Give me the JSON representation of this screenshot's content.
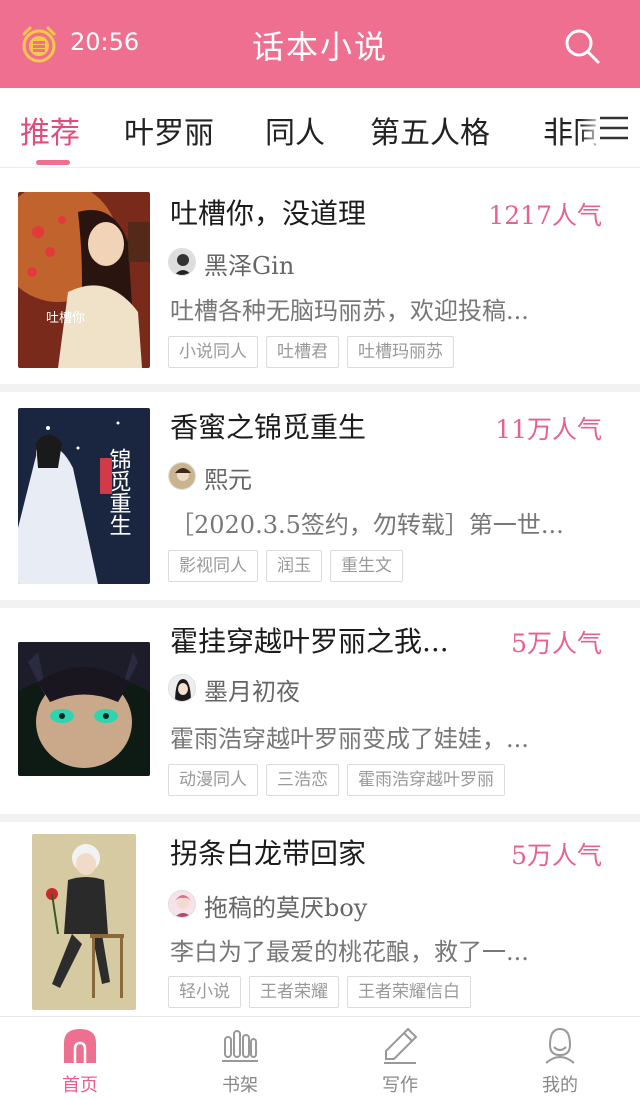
{
  "status": {
    "time": "20:56"
  },
  "appbar": {
    "title": "话本小说",
    "brand_color": "#ee6f8f"
  },
  "tabs": [
    {
      "label": "推荐",
      "active": true
    },
    {
      "label": "叶罗丽",
      "active": false
    },
    {
      "label": "同人",
      "active": false
    },
    {
      "label": "第五人格",
      "active": false
    },
    {
      "label": "非同",
      "active": false
    }
  ],
  "books": [
    {
      "title": "吐槽你，没道理",
      "popularity": "1217人气",
      "author": "黑泽Gin",
      "summary": "吐槽各种无脑玛丽苏，欢迎投稿...",
      "tags": [
        "小说同人",
        "吐槽君",
        "吐槽玛丽苏"
      ],
      "cover_text": "吐槽你"
    },
    {
      "title": "香蜜之锦觅重生",
      "popularity": "11万人气",
      "author": "熙元",
      "summary": "［2020.3.5签约，勿转载］第一世...",
      "tags": [
        "影视同人",
        "润玉",
        "重生文"
      ],
      "cover_text": "锦觅重生"
    },
    {
      "title": "霍挂穿越叶罗丽之我...",
      "popularity": "5万人气",
      "author": "墨月初夜",
      "summary": "霍雨浩穿越叶罗丽变成了娃娃，...",
      "tags": [
        "动漫同人",
        "三浩恋",
        "霍雨浩穿越叶罗丽"
      ],
      "cover_text": ""
    },
    {
      "title": "拐条白龙带回家",
      "popularity": "5万人气",
      "author": "拖稿的莫厌boy",
      "summary": "李白为了最爱的桃花酿，救了一...",
      "tags": [
        "轻小说",
        "王者荣耀",
        "王者荣耀信白"
      ],
      "cover_text": ""
    }
  ],
  "bottom_nav": [
    {
      "label": "首页",
      "icon": "home-icon",
      "active": true
    },
    {
      "label": "书架",
      "icon": "bookshelf-icon",
      "active": false
    },
    {
      "label": "写作",
      "icon": "pencil-icon",
      "active": false
    },
    {
      "label": "我的",
      "icon": "profile-icon",
      "active": false
    }
  ]
}
